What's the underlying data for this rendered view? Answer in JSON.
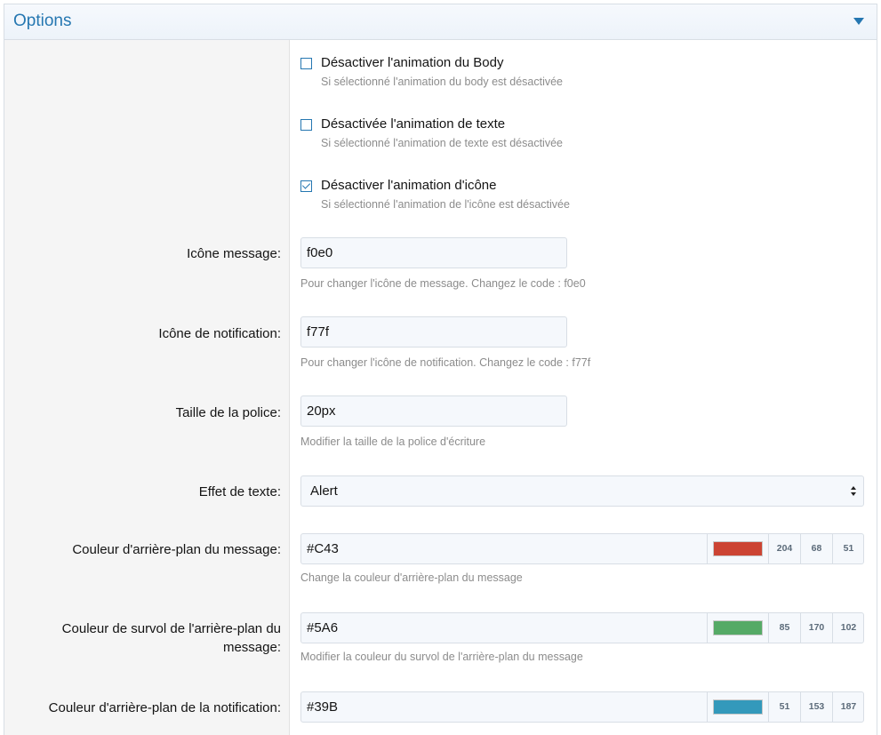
{
  "panel": {
    "title": "Options"
  },
  "checkboxes": [
    {
      "label": "Désactiver l'animation du Body",
      "hint": "Si sélectionné l'animation du body est désactivée",
      "checked": false
    },
    {
      "label": "Désactivée l'animation de texte",
      "hint": "Si sélectionné l'animation de texte est désactivée",
      "checked": false
    },
    {
      "label": "Désactiver l'animation d'icône",
      "hint": "Si sélectionné l'animation de l'icône est désactivée",
      "checked": true
    }
  ],
  "fields": {
    "message_icon": {
      "label": "Icône message:",
      "value": "f0e0",
      "hint": "Pour changer l'icône de message. Changez le code : f0e0"
    },
    "notification_icon": {
      "label": "Icône de notification:",
      "value": "f77f",
      "hint": "Pour changer l'icône de notification. Changez le code : f77f"
    },
    "font_size": {
      "label": "Taille de la police:",
      "value": "20px",
      "hint": "Modifier la taille de la police d'écriture"
    },
    "text_effect": {
      "label": "Effet de texte:",
      "selected": "Alert"
    },
    "message_bg": {
      "label": "Couleur d'arrière-plan du message:",
      "value": "#C43",
      "hint": "Change la couleur d'arrière-plan du message",
      "color": "#cc4433",
      "r": "204",
      "g": "68",
      "b": "51"
    },
    "message_hover_bg": {
      "label_line1": "Couleur de survol de l'arrière-plan du",
      "label_line2": "message:",
      "value": "#5A6",
      "hint": "Modifier la couleur du survol de l'arrière-plan du message",
      "color": "#55aa66",
      "r": "85",
      "g": "170",
      "b": "102"
    },
    "notification_bg": {
      "label": "Couleur d'arrière-plan de la notification:",
      "value": "#39B",
      "color": "#3399bb",
      "r": "51",
      "g": "153",
      "b": "187"
    }
  },
  "colors": {
    "accent": "#2577b1",
    "left_column_bg": "#f5f5f5",
    "hint_text": "#8c8c8c"
  }
}
